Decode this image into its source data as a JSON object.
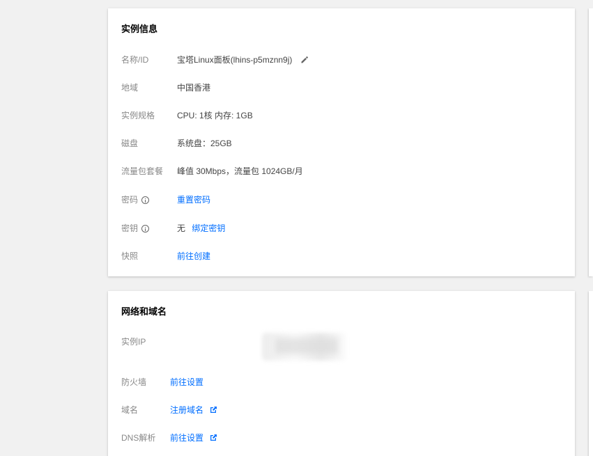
{
  "instance_info": {
    "title": "实例信息",
    "rows": {
      "name": {
        "label": "名称/ID",
        "value": "宝塔Linux面板(lhins-p5mznn9j)"
      },
      "region": {
        "label": "地域",
        "value": "中国香港"
      },
      "spec": {
        "label": "实例规格",
        "value": "CPU: 1核 内存: 1GB"
      },
      "disk": {
        "label": "磁盘",
        "value": "系统盘：25GB"
      },
      "traffic": {
        "label": "流量包套餐",
        "value": "峰值 30Mbps，流量包 1024GB/月"
      },
      "password": {
        "label": "密码",
        "link": "重置密码"
      },
      "keypair": {
        "label": "密钥",
        "value": "无",
        "link": "绑定密钥"
      },
      "snapshot": {
        "label": "快照",
        "link": "前往创建"
      }
    }
  },
  "network": {
    "title": "网络和域名",
    "rows": {
      "ip": {
        "label": "实例IP"
      },
      "firewall": {
        "label": "防火墙",
        "link": "前往设置"
      },
      "domain": {
        "label": "域名",
        "link": "注册域名"
      },
      "dns": {
        "label": "DNS解析",
        "link": "前往设置"
      }
    }
  },
  "colors": {
    "link": "#006eff",
    "label": "#888888",
    "background": "#f1f1f1"
  },
  "icons": {
    "edit": "pencil-icon",
    "info": "info-circle-icon",
    "external": "external-link-icon"
  }
}
